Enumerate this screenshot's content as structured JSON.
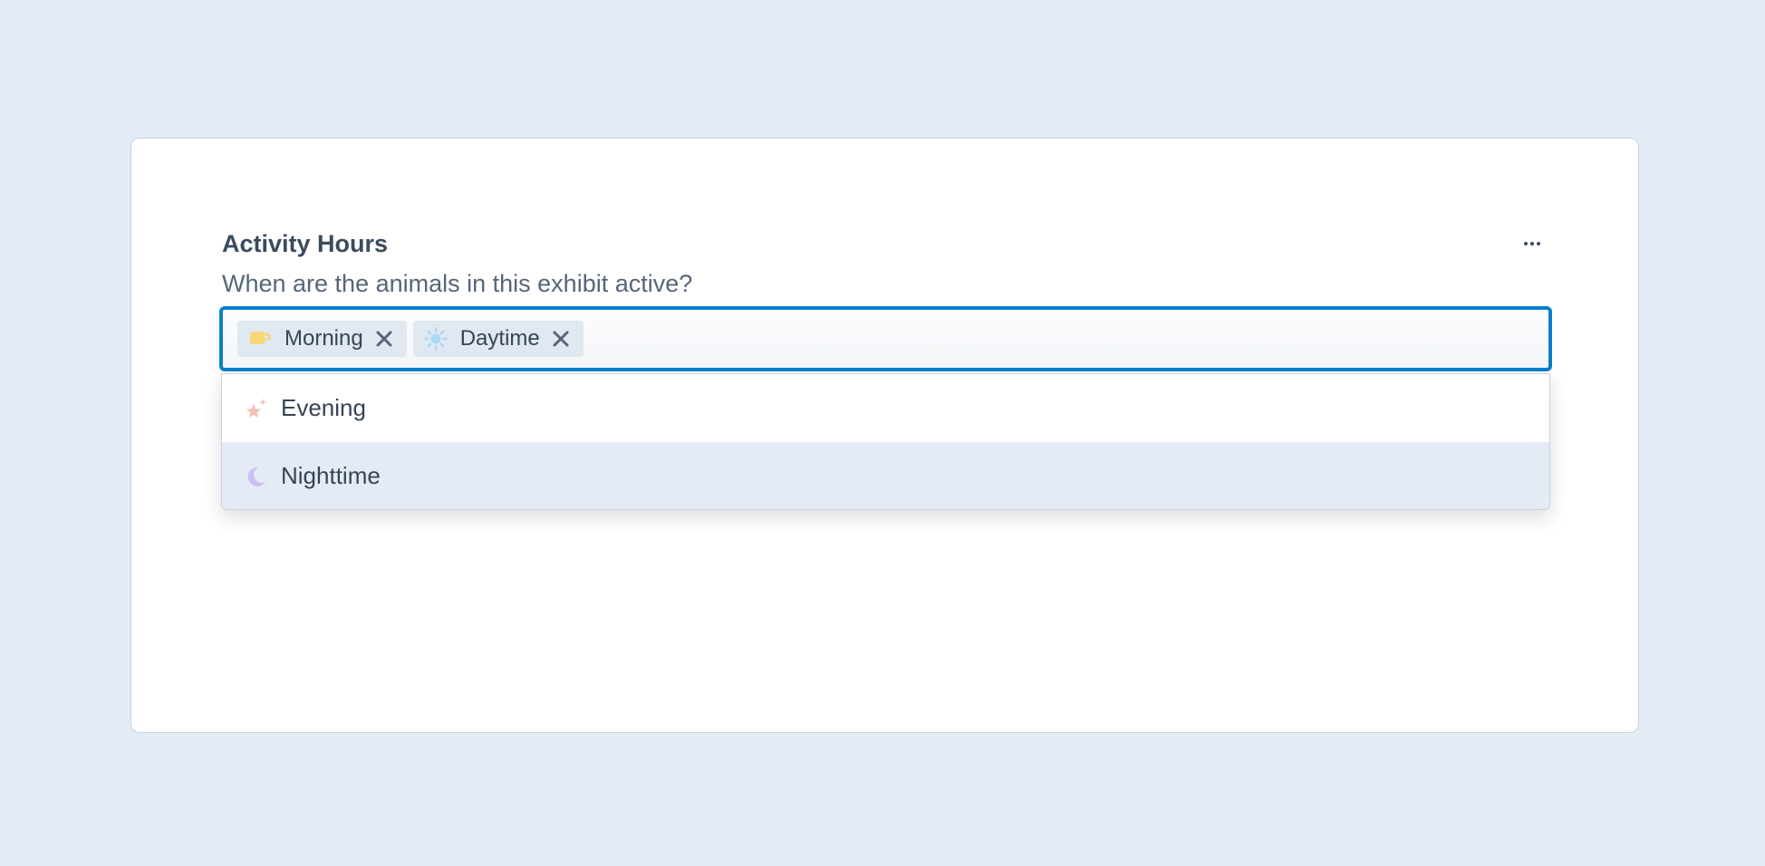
{
  "field": {
    "title": "Activity Hours",
    "description": "When are the animals in this exhibit active?",
    "more_icon": "ellipsis-icon"
  },
  "selected_tags": [
    {
      "label": "Morning",
      "icon": "coffee-cup-icon",
      "icon_color": "#f7d77a",
      "remove_icon": "close-icon"
    },
    {
      "label": "Daytime",
      "icon": "sun-icon",
      "icon_color": "#a9d8f5",
      "remove_icon": "close-icon"
    }
  ],
  "dropdown": {
    "options": [
      {
        "label": "Evening",
        "icon": "sparkle-star-icon",
        "icon_color": "#f6c1b4",
        "highlighted": false
      },
      {
        "label": "Nighttime",
        "icon": "moon-icon",
        "icon_color": "#cdbff5",
        "highlighted": true
      }
    ]
  },
  "colors": {
    "background": "#e3ebf4",
    "focus_border": "#0b7fca",
    "text": "#364456",
    "tag_background": "#e0e8f1",
    "highlight_background": "#e4ebf4"
  }
}
